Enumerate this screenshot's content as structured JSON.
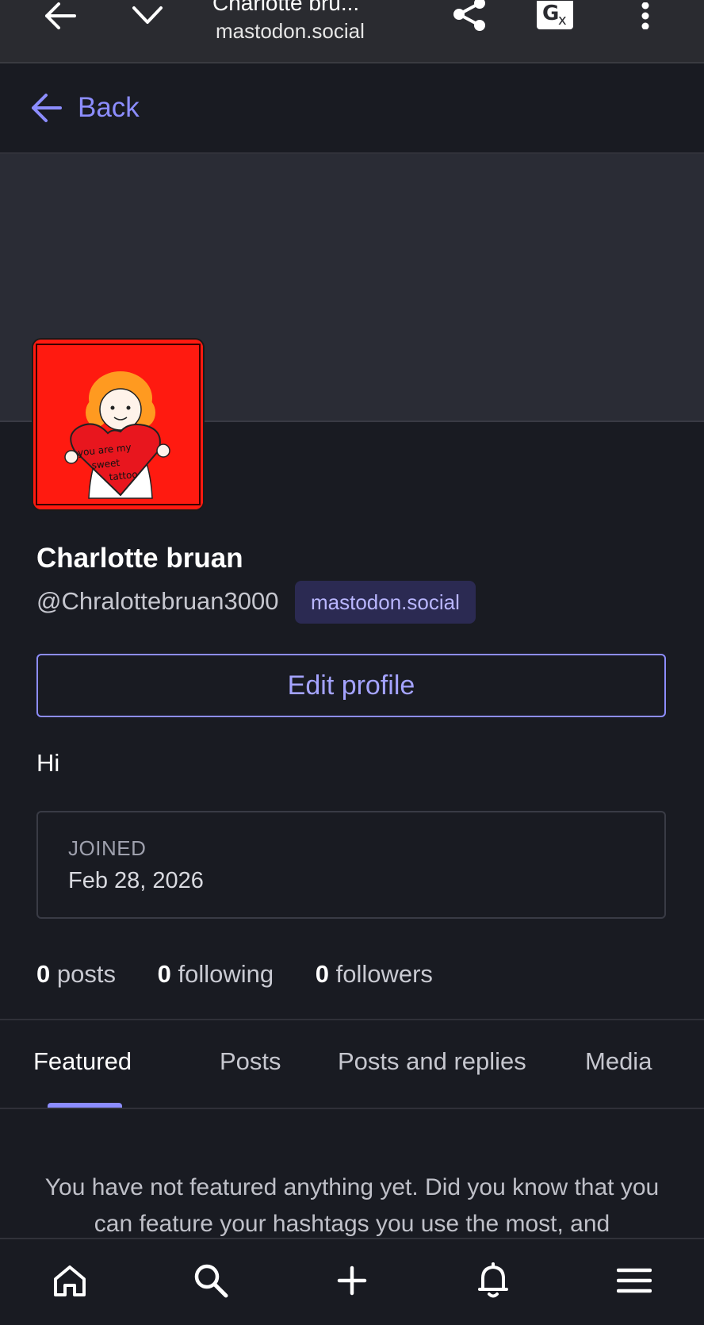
{
  "browser": {
    "tab_title": "Charlotte bru...",
    "url": "mastodon.social"
  },
  "header": {
    "back_label": "Back"
  },
  "profile": {
    "display_name": "Charlotte bruan",
    "handle": "@Chralottebruan3000",
    "domain": "mastodon.social",
    "edit_label": "Edit profile",
    "bio": "Hi",
    "joined_label": "JOINED",
    "joined_date": "Feb 28, 2026",
    "avatar_text": "you are my sweet tattoo"
  },
  "stats": {
    "posts_count": "0",
    "posts_label": "posts",
    "following_count": "0",
    "following_label": "following",
    "followers_count": "0",
    "followers_label": "followers"
  },
  "tabs": [
    {
      "label": "Featured",
      "active": true
    },
    {
      "label": "Posts"
    },
    {
      "label": "Posts and replies"
    },
    {
      "label": "Media"
    }
  ],
  "empty_state": "You have not featured anything yet. Did you know that you can feature your hashtags you use the most, and",
  "bottom_nav": [
    "home-icon",
    "search-icon",
    "compose-icon",
    "notifications-icon",
    "menu-icon"
  ],
  "colors": {
    "accent": "#8c8dff",
    "background": "#191b22",
    "banner": "#2a2c35",
    "avatar_bg": "#ff1a10"
  }
}
